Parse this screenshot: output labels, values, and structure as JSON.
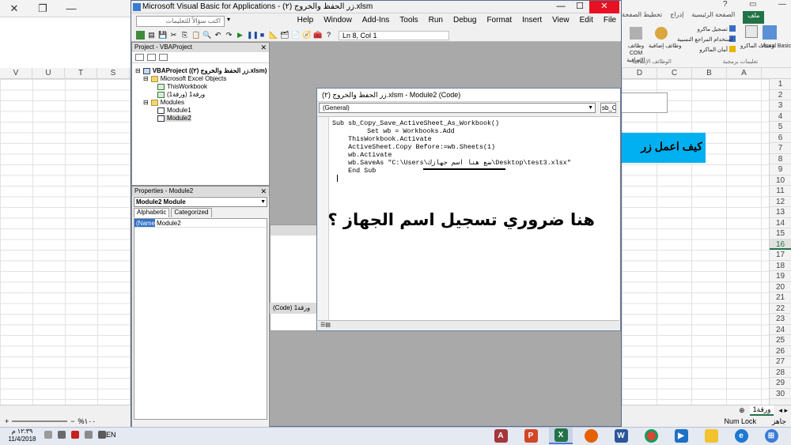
{
  "excel": {
    "tabs": [
      "ملف",
      "الصفحة الرئيسية",
      "إدراج",
      "تخطيط الصفحة"
    ],
    "ribbon": {
      "visual_basic": "Visual Basic",
      "macros": "وحدات الماكرو",
      "record_macro": "تسجيل ماكرو",
      "use_relative": "استخدام المراجع النسبية",
      "macro_security": "أمان الماكرو",
      "group_code": "تعليمات برمجية",
      "addins": "وظائف إضافية",
      "com_addins": "وظائف COM الإضافية",
      "group_addins": "الوظائف الإضافية"
    },
    "columns_right": [
      "D",
      "C",
      "B",
      "A"
    ],
    "columns_left": [
      "V",
      "U",
      "T",
      "S"
    ],
    "rows": [
      "1",
      "2",
      "3",
      "4",
      "5",
      "6",
      "7",
      "8",
      "9",
      "10",
      "11",
      "12",
      "13",
      "14",
      "15",
      "16",
      "17",
      "18",
      "19",
      "20",
      "21",
      "22",
      "23",
      "24",
      "25",
      "26",
      "27",
      "28",
      "29",
      "30"
    ],
    "selected_row": "16",
    "blue_cell_text": "كيف اعمل زر",
    "sheet_tab": "ورقة1",
    "status_numlock": "Num Lock",
    "status_ready": "جاهز",
    "zoom": "%١٠٠"
  },
  "vba": {
    "title": "Microsoft Visual Basic for Applications - زر الحفظ والخروج (٢).xlsm",
    "help_placeholder": "اكتب سؤالاً للتعليمات",
    "menu": [
      "File",
      "Edit",
      "View",
      "Insert",
      "Format",
      "Debug",
      "Run",
      "Tools",
      "Add-Ins",
      "Window",
      "Help"
    ],
    "cursor_position": "Ln 8, Col 1",
    "project_panel_title": "Project - VBAProject",
    "tree": {
      "project": "VBAProject (زر الحفظ والخروج (٢).xlsm)",
      "excel_objects": "Microsoft Excel Objects",
      "this_workbook": "ThisWorkbook",
      "sheet1": "ورقة1 (ورقة1)",
      "modules": "Modules",
      "module1": "Module1",
      "module2": "Module2"
    },
    "properties_title": "Properties - Module2",
    "properties_object": "Module2 Module",
    "properties_tabs": [
      "Alphabetic",
      "Categorized"
    ],
    "property_name_key": "(Name)",
    "property_name_value": "Module2",
    "bg_code_title": "ورقة1 (Code)",
    "code_window_title": "زر الحفظ والخروج (٢).xlsm - Module2 (Code)",
    "general_combo": "(General)",
    "proc_combo": "sb_Copy_Save_ActiveSheet_As_Workbook",
    "code_lines": [
      "Sub sb_Copy_Save_ActiveSheet_As_Workbook()",
      "    Set wb = Workbooks.Add",
      "    ThisWorkbook.Activate",
      "    ActiveSheet.Copy Before:=wb.Sheets(1)",
      "    wb.Activate",
      "    wb.SaveAs \"C:\\Users\\ضع هنا اسم جهازك\\Desktop\\test3.xlsx\"",
      "    End Sub"
    ],
    "overlay_note": "هنا ضروري تسجيل اسم الجهاز ؟"
  },
  "taskbar": {
    "time": "١٢:٣٩ م",
    "date": "11/4/2018",
    "lang": "EN"
  }
}
